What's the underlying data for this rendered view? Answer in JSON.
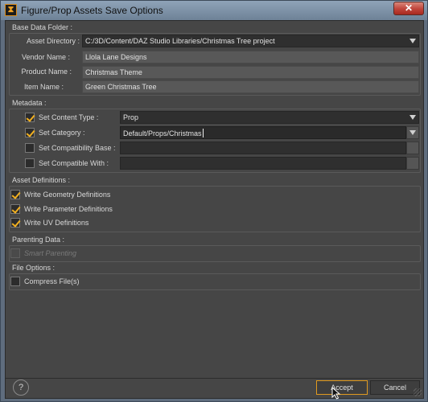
{
  "window": {
    "title": "Figure/Prop Assets Save Options",
    "app_icon_glyph": "⧗",
    "close_glyph": "✕"
  },
  "base_data": {
    "title": "Base Data Folder :",
    "asset_directory": {
      "label": "Asset Directory :",
      "value": "C:/3D/Content/DAZ Studio Libraries/Christmas Tree project"
    },
    "vendor_name": {
      "label": "Vendor Name :",
      "value": "Llola Lane Designs"
    },
    "product_name": {
      "label": "Product Name :",
      "value": "Christmas Theme"
    },
    "item_name": {
      "label": "Item Name :",
      "value": "Green Christmas Tree"
    }
  },
  "metadata": {
    "title": "Metadata :",
    "set_content_type": {
      "label": "Set Content Type :",
      "checked": true,
      "value": "Prop"
    },
    "set_category": {
      "label": "Set Category :",
      "checked": true,
      "value": "Default/Props/Christmas"
    },
    "set_compat_base": {
      "label": "Set Compatibility Base :",
      "checked": false,
      "value": ""
    },
    "set_compatible_with": {
      "label": "Set Compatible With :",
      "checked": false,
      "value": ""
    }
  },
  "asset_definitions": {
    "title": "Asset Definitions :",
    "items": [
      {
        "label": "Write Geometry Definitions",
        "checked": true
      },
      {
        "label": "Write Parameter Definitions",
        "checked": true
      },
      {
        "label": "Write UV Definitions",
        "checked": true
      }
    ]
  },
  "parenting": {
    "title": "Parenting Data :",
    "smart_parenting": {
      "label": "Smart Parenting",
      "checked": false,
      "enabled": false
    }
  },
  "file_options": {
    "title": "File Options :",
    "compress": {
      "label": "Compress File(s)",
      "checked": false
    }
  },
  "footer": {
    "help_glyph": "?",
    "accept_label": "Accept",
    "cancel_label": "Cancel"
  },
  "colors": {
    "accent": "#f2b020",
    "dialog_bg": "#464646",
    "titlebar": "#8fa3b8"
  }
}
